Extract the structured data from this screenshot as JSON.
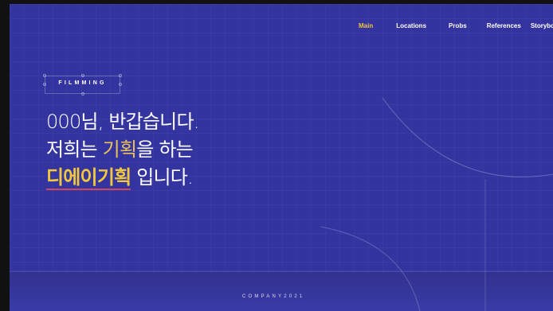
{
  "nav": {
    "items": [
      {
        "label": "Main",
        "active": true
      },
      {
        "label": "Locations",
        "active": false
      },
      {
        "label": "Probs",
        "active": false
      },
      {
        "label": "References",
        "active": false
      },
      {
        "label": "Storyboa",
        "active": false
      }
    ]
  },
  "hero": {
    "tag": "FILMMING",
    "line1": "000님, 반갑습니다.",
    "line2_prefix": "저희는 ",
    "line2_highlight": "기획",
    "line2_suffix": "을 하는",
    "line3_highlight": "디에이기획",
    "line3_suffix": " 입니다."
  },
  "footer": {
    "text": "COMPANY2021"
  },
  "colors": {
    "background": "#3434A0",
    "active_nav": "#F0C43B",
    "highlight_soft": "#E8C05A",
    "highlight_strong": "#F1C73B",
    "underline": "#D94B57"
  }
}
